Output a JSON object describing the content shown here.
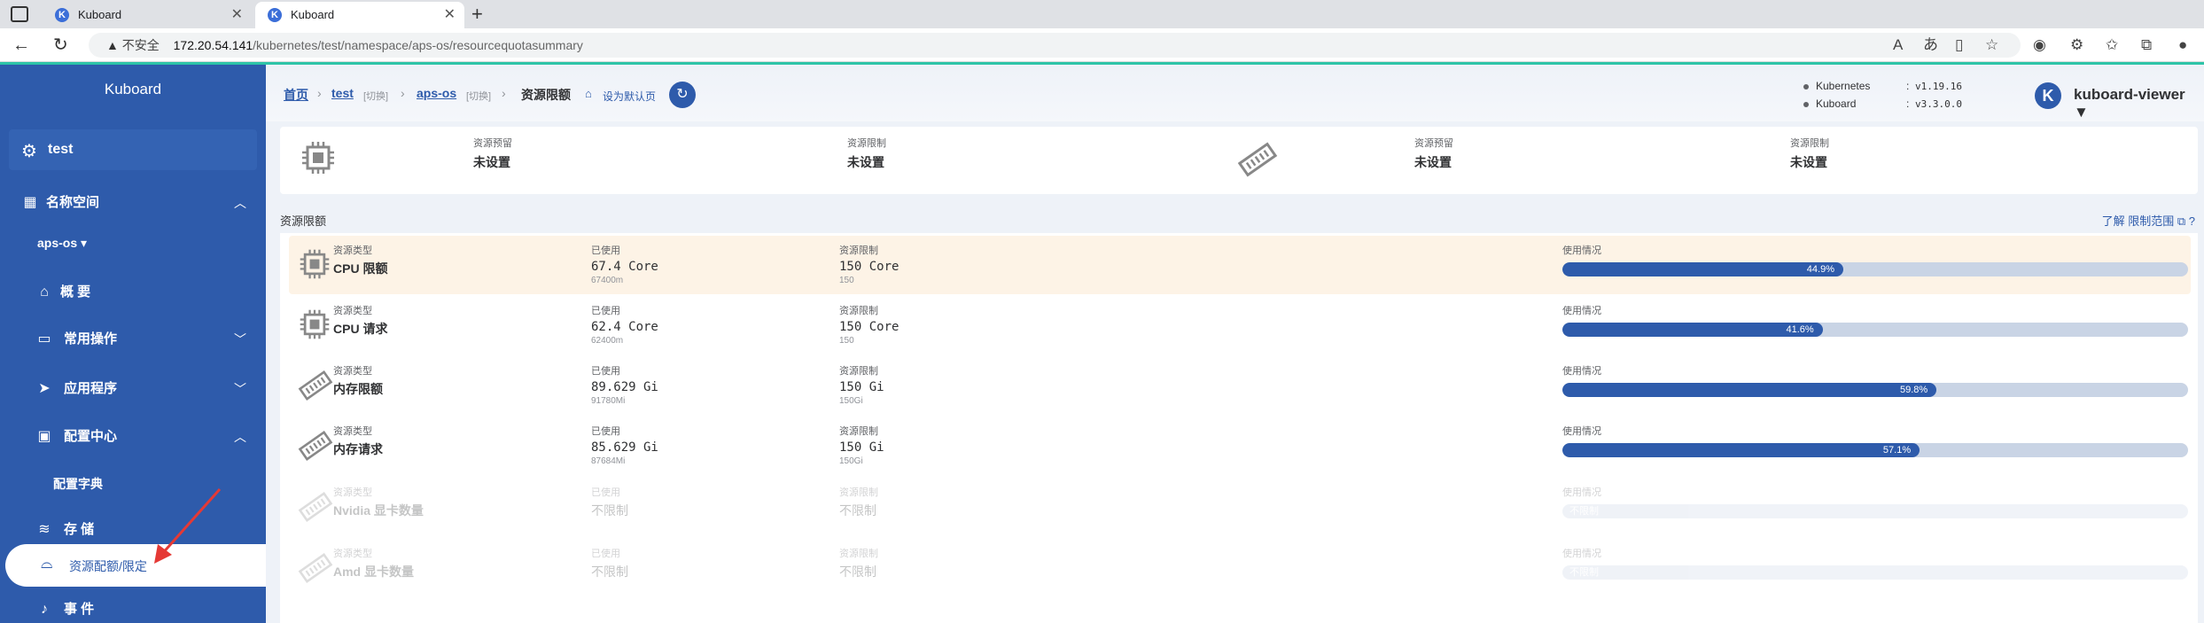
{
  "browser": {
    "tabs": [
      {
        "title": "Kuboard",
        "active": false
      },
      {
        "title": "Kuboard",
        "active": true
      }
    ],
    "url_insecure": "不安全",
    "url_host": "172.20.54.141",
    "url_path": "/kubernetes/test/namespace/aps-os/resourcequotasummary"
  },
  "sidebar": {
    "brand": "Kuboard",
    "cluster": "test",
    "namespace_menu": "名称空间",
    "namespace_current": "aps-os",
    "items": {
      "overview": "概 要",
      "common_ops": "常用操作",
      "apps": "应用程序",
      "config_center": "配置中心",
      "config_dict": "配置字典",
      "storage": "存 储",
      "quota": "资源配额/限定",
      "events": "事 件"
    }
  },
  "breadcrumb": {
    "home": "首页",
    "cluster": "test",
    "switch1": "[切换]",
    "namespace": "aps-os",
    "switch2": "[切换]",
    "current": "资源限额",
    "set_default": "设为默认页"
  },
  "versions": {
    "k8s_label": "Kubernetes",
    "k8s_value": "v1.19.16",
    "kuboard_label": "Kuboard",
    "kuboard_value": "v3.3.0.0"
  },
  "user": {
    "avatar": "K",
    "name": "kuboard-viewer ▼"
  },
  "defaults_card": {
    "cpu_request_label": "资源预留",
    "cpu_request_value": "未设置",
    "cpu_limit_label": "资源限制",
    "cpu_limit_value": "未设置",
    "mem_request_label": "资源预留",
    "mem_request_value": "未设置",
    "mem_limit_label": "资源限制",
    "mem_limit_value": "未设置"
  },
  "quota_section": {
    "title": "资源限额",
    "help_link": "了解 限制范围 ⧉ ?"
  },
  "column_labels": {
    "type": "资源类型",
    "used": "已使用",
    "limit": "资源限制",
    "usage": "使用情况"
  },
  "quota_rows": [
    {
      "name": "CPU 限额",
      "used": "67.4 Core",
      "used_raw": "67400m",
      "limit": "150 Core",
      "limit_raw": "150",
      "percent": 44.9,
      "percent_label": "44.9%",
      "icon": "cpu-icon"
    },
    {
      "name": "CPU 请求",
      "used": "62.4 Core",
      "used_raw": "62400m",
      "limit": "150 Core",
      "limit_raw": "150",
      "percent": 41.6,
      "percent_label": "41.6%",
      "icon": "cpu-icon"
    },
    {
      "name": "内存限额",
      "used": "89.629 Gi",
      "used_raw": "91780Mi",
      "limit": "150 Gi",
      "limit_raw": "150Gi",
      "percent": 59.8,
      "percent_label": "59.8%",
      "icon": "memory-icon"
    },
    {
      "name": "内存请求",
      "used": "85.629 Gi",
      "used_raw": "87684Mi",
      "limit": "150 Gi",
      "limit_raw": "150Gi",
      "percent": 57.1,
      "percent_label": "57.1%",
      "icon": "memory-icon"
    },
    {
      "name": "Nvidia 显卡数量",
      "used": "不限制",
      "used_raw": "",
      "limit": "不限制",
      "limit_raw": "",
      "percent": 0,
      "percent_label": "不限制",
      "icon": "memory-icon"
    },
    {
      "name": "Amd 显卡数量",
      "used": "不限制",
      "used_raw": "",
      "limit": "不限制",
      "limit_raw": "",
      "percent": 0,
      "percent_label": "不限制",
      "icon": "memory-icon"
    }
  ],
  "colors": {
    "primary": "#2e5bab",
    "highlight_row": "#fdf3e6",
    "progress_track": "#c9d4e5",
    "teal": "#2ec4a8"
  }
}
